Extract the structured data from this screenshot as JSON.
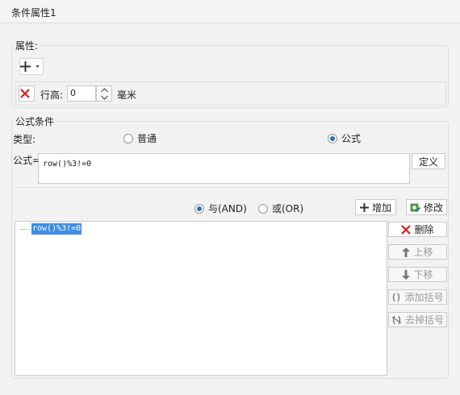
{
  "window": {
    "title": "条件属性1"
  },
  "attributes": {
    "legend": "属性:",
    "add_icon": "plus-icon",
    "row_height_label": "行高:",
    "row_height_value": "0",
    "unit": "毫米"
  },
  "formula_condition": {
    "legend": "公式条件",
    "type_label": "类型:",
    "type_options": [
      {
        "label": "普通",
        "selected": false
      },
      {
        "label": "公式",
        "selected": true
      }
    ],
    "formula_label": "公式=",
    "formula_value": "row()%3!=0",
    "define_button": "定义",
    "logic_options": [
      {
        "label": "与(AND)",
        "selected": true
      },
      {
        "label": "或(OR)",
        "selected": false
      }
    ],
    "add_button": "增加",
    "modify_button": "修改",
    "conditions": [
      "row()%3!=0"
    ],
    "side_buttons": {
      "delete": "删除",
      "move_up": "上移",
      "move_down": "下移",
      "add_bracket": "添加括号",
      "remove_bracket": "去掉括号"
    }
  },
  "colors": {
    "accent": "#1e73c8",
    "delete_red": "#d42020",
    "selection": "#3d8ee6"
  }
}
